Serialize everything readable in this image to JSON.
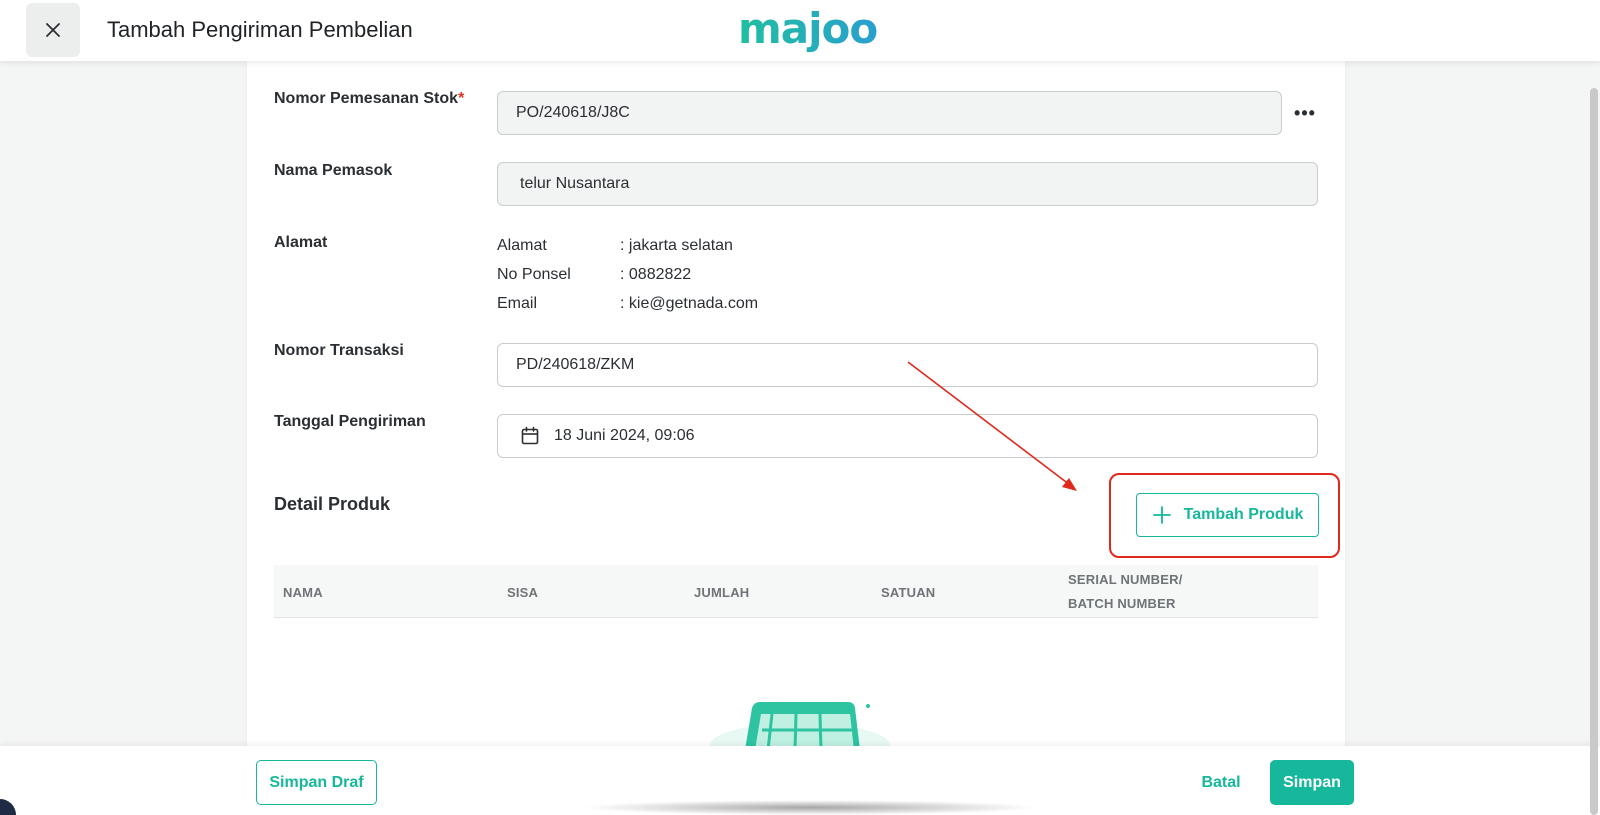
{
  "header": {
    "title": "Tambah Pengiriman Pembelian",
    "logo_text": "majoo"
  },
  "form": {
    "po_number": {
      "label": "Nomor Pemesanan Stok",
      "required_mark": "*",
      "value": "PO/240618/J8C"
    },
    "supplier": {
      "label": "Nama Pemasok",
      "value": "telur Nusantara"
    },
    "address": {
      "label": "Alamat",
      "rows": [
        {
          "key": "Alamat",
          "value": ": jakarta selatan"
        },
        {
          "key": "No Ponsel",
          "value": ": 0882822"
        },
        {
          "key": "Email",
          "value": ": kie@getnada.com"
        }
      ]
    },
    "transaction_number": {
      "label": "Nomor Transaksi",
      "value": "PD/240618/ZKM"
    },
    "shipping_date": {
      "label": "Tanggal Pengiriman",
      "value": "18 Juni 2024, 09:06"
    }
  },
  "product_section": {
    "title": "Detail Produk",
    "add_button": "Tambah Produk",
    "columns": [
      "NAMA",
      "SISA",
      "JUMLAH",
      "SATUAN"
    ],
    "serial_column_line1": "SERIAL NUMBER/",
    "serial_column_line2": "BATCH NUMBER"
  },
  "footer": {
    "draft_button": "Simpan Draf",
    "cancel_button": "Batal",
    "save_button": "Simpan"
  },
  "colors": {
    "accent": "#16b79b",
    "annotation": "#e0281c"
  }
}
